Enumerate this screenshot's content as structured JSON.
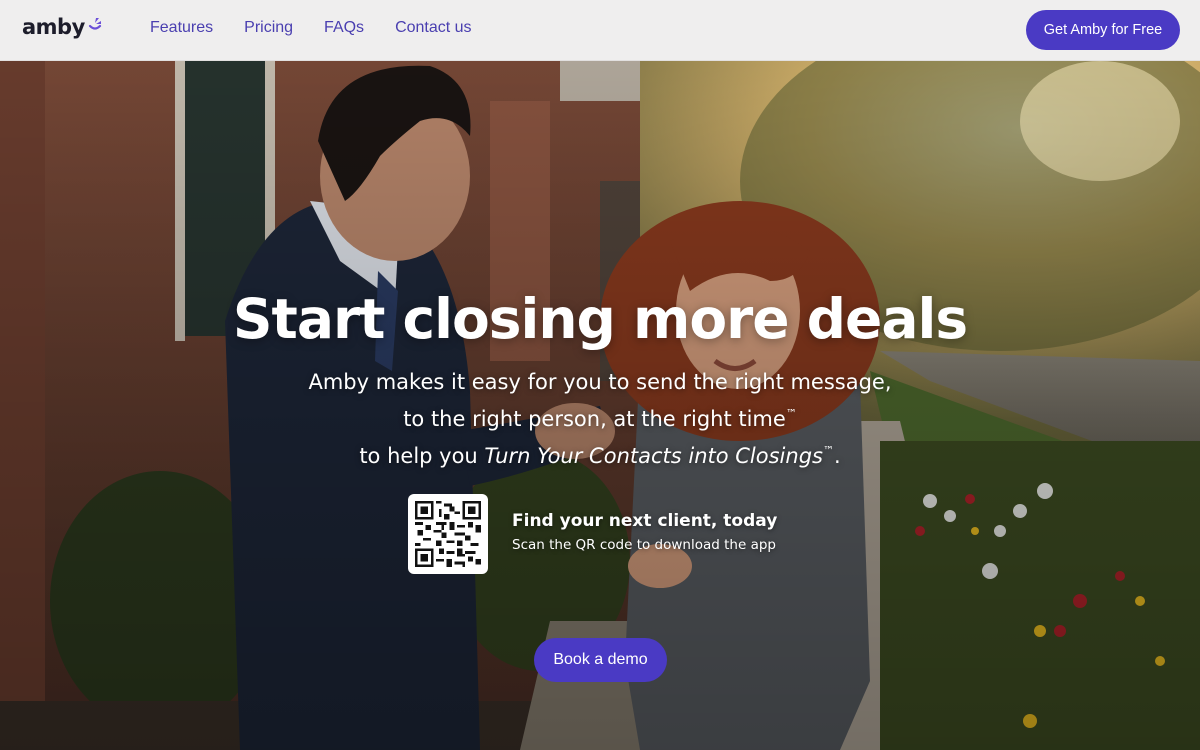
{
  "header": {
    "logo": "amby",
    "nav": [
      "Features",
      "Pricing",
      "FAQs",
      "Contact us"
    ],
    "cta_label": "Get Amby for Free"
  },
  "hero": {
    "headline": "Start closing more deals",
    "line1": "Amby makes it easy for you to send the right message,",
    "line2": "to the right person, at the right time",
    "line3_prefix": "to help you ",
    "line3_italic": "Turn Your Contacts into Closings",
    "line3_suffix": ".",
    "tm": "™",
    "qr_title": "Find your next client, today",
    "qr_subtitle": "Scan the QR code to download the app",
    "demo_label": "Book a demo"
  },
  "colors": {
    "brand": "#4a3ac4",
    "nav_link": "#4a3fb0",
    "header_bg": "#efeeee"
  },
  "icons": {
    "logo_mark": "amby-sparkle-icon",
    "qr": "qr-code-icon"
  }
}
